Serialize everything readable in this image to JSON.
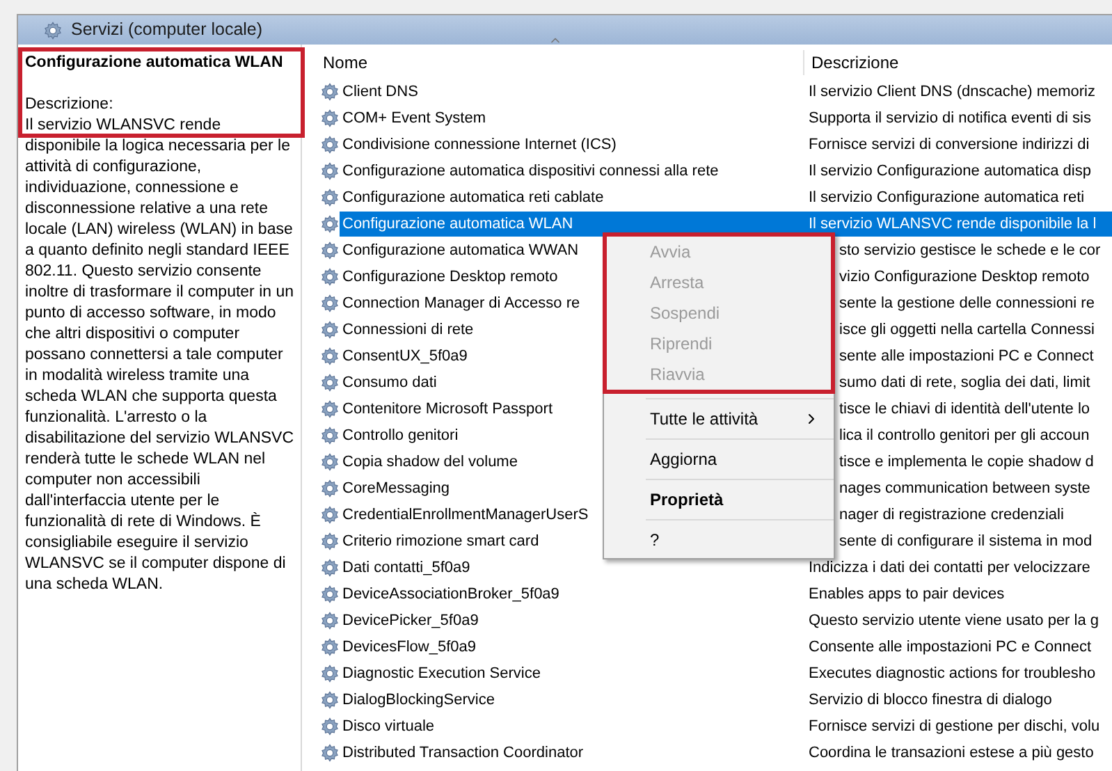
{
  "header": {
    "title": "Servizi (computer locale)"
  },
  "details": {
    "title": "Configurazione automatica WLAN",
    "label": "Descrizione:",
    "text": "Il servizio WLANSVC rende disponibile la logica necessaria per le attività di configurazione, individuazione, connessione e disconnessione relative a una rete locale (LAN) wireless (WLAN) in base a quanto definito negli standard IEEE 802.11. Questo servizio consente inoltre di trasformare il computer in un punto di accesso software, in modo che altri dispositivi o computer possano connettersi a tale computer in modalità wireless tramite una scheda WLAN che supporta questa funzionalità. L'arresto o la disabilitazione del servizio WLANSVC renderà tutte le schede WLAN nel computer non accessibili dall'interfaccia utente per le funzionalità di rete di Windows. È consigliabile eseguire il servizio WLANSVC se il computer dispone di una scheda WLAN.",
    "highlighted": true
  },
  "table": {
    "columns": [
      "Nome",
      "Descrizione"
    ],
    "rows": [
      {
        "name": "Client DNS",
        "description": "Il servizio Client DNS (dnscache) memoriz",
        "selected": false,
        "obscured": false
      },
      {
        "name": "COM+ Event System",
        "description": "Supporta il servizio di notifica eventi di sis",
        "selected": false,
        "obscured": false
      },
      {
        "name": "Condivisione connessione Internet (ICS)",
        "description": "Fornisce servizi di conversione indirizzi di",
        "selected": false,
        "obscured": false
      },
      {
        "name": "Configurazione automatica dispositivi connessi alla rete",
        "description": "Il servizio Configurazione automatica disp",
        "selected": false,
        "obscured": false
      },
      {
        "name": "Configurazione automatica reti cablate",
        "description": "Il servizio Configurazione automatica reti",
        "selected": false,
        "obscured": false
      },
      {
        "name": "Configurazione automatica WLAN",
        "description": "Il servizio WLANSVC rende disponibile la l",
        "selected": true,
        "obscured": false
      },
      {
        "name": "Configurazione automatica WWAN",
        "description": "sto servizio gestisce le schede e le cor",
        "selected": false,
        "obscured": true
      },
      {
        "name": "Configurazione Desktop remoto",
        "description": "vizio Configurazione Desktop remoto",
        "selected": false,
        "obscured": true
      },
      {
        "name": "Connection Manager di Accesso re",
        "description": "sente la gestione delle connessioni re",
        "selected": false,
        "obscured": true
      },
      {
        "name": "Connessioni di rete",
        "description": "isce gli oggetti nella cartella Connessi",
        "selected": false,
        "obscured": true
      },
      {
        "name": "ConsentUX_5f0a9",
        "description": "sente alle impostazioni PC e Connect",
        "selected": false,
        "obscured": true
      },
      {
        "name": "Consumo dati",
        "description": "sumo dati di rete, soglia dei dati, limit",
        "selected": false,
        "obscured": true
      },
      {
        "name": "Contenitore Microsoft Passport",
        "description": "tisce le chiavi di identità dell'utente lo",
        "selected": false,
        "obscured": true
      },
      {
        "name": "Controllo genitori",
        "description": "lica il controllo genitori per gli accoun",
        "selected": false,
        "obscured": true
      },
      {
        "name": "Copia shadow del volume",
        "description": "tisce e implementa le copie shadow d",
        "selected": false,
        "obscured": true
      },
      {
        "name": "CoreMessaging",
        "description": "nages communication between syste",
        "selected": false,
        "obscured": true
      },
      {
        "name": "CredentialEnrollmentManagerUserS",
        "description": "nager di registrazione credenziali",
        "selected": false,
        "obscured": true
      },
      {
        "name": "Criterio rimozione smart card",
        "description": "sente di configurare il sistema in mod",
        "selected": false,
        "obscured": true
      },
      {
        "name": "Dati contatti_5f0a9",
        "description": "Indicizza i dati dei contatti per velocizzare",
        "selected": false,
        "obscured": false
      },
      {
        "name": "DeviceAssociationBroker_5f0a9",
        "description": "Enables apps to pair devices",
        "selected": false,
        "obscured": false
      },
      {
        "name": "DevicePicker_5f0a9",
        "description": "Questo servizio utente viene usato per la g",
        "selected": false,
        "obscured": false
      },
      {
        "name": "DevicesFlow_5f0a9",
        "description": "Consente alle impostazioni PC e Connect",
        "selected": false,
        "obscured": false
      },
      {
        "name": "Diagnostic Execution Service",
        "description": "Executes diagnostic actions for troublesho",
        "selected": false,
        "obscured": false
      },
      {
        "name": "DialogBlockingService",
        "description": "Servizio di blocco finestra di dialogo",
        "selected": false,
        "obscured": false
      },
      {
        "name": "Disco virtuale",
        "description": "Fornisce servizi di gestione per dischi, volu",
        "selected": false,
        "obscured": false
      },
      {
        "name": "Distributed Transaction Coordinator",
        "description": "Coordina le transazioni estese a più gesto",
        "selected": false,
        "obscured": false
      }
    ]
  },
  "context_menu": {
    "groups": [
      {
        "highlighted": true,
        "items": [
          {
            "label": "Avvia",
            "disabled": true,
            "default": false,
            "submenu": false
          },
          {
            "label": "Arresta",
            "disabled": true,
            "default": false,
            "submenu": false
          },
          {
            "label": "Sospendi",
            "disabled": true,
            "default": false,
            "submenu": false
          },
          {
            "label": "Riprendi",
            "disabled": true,
            "default": false,
            "submenu": false
          },
          {
            "label": "Riavvia",
            "disabled": true,
            "default": false,
            "submenu": false
          }
        ]
      },
      {
        "highlighted": false,
        "items": [
          {
            "label": "Tutte le attività",
            "disabled": false,
            "default": false,
            "submenu": true
          }
        ]
      },
      {
        "highlighted": false,
        "items": [
          {
            "label": "Aggiorna",
            "disabled": false,
            "default": false,
            "submenu": false
          }
        ]
      },
      {
        "highlighted": false,
        "items": [
          {
            "label": "Proprietà",
            "disabled": false,
            "default": true,
            "submenu": false
          }
        ]
      },
      {
        "highlighted": false,
        "items": [
          {
            "label": "?",
            "disabled": false,
            "default": false,
            "submenu": false
          }
        ]
      }
    ]
  }
}
